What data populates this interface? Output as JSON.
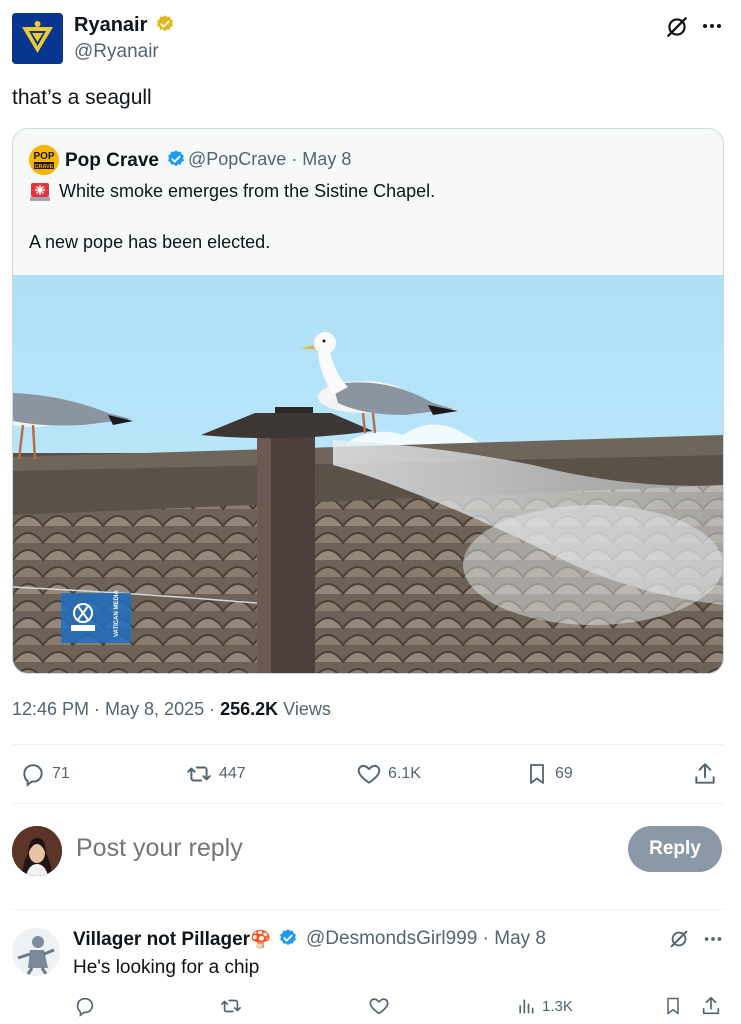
{
  "tweet": {
    "author_name": "Ryanair",
    "author_handle": "@Ryanair",
    "text": "that’s a seagull",
    "time": "12:46 PM · May 8, 2025 · ",
    "views_count": "256.2K",
    "views_label": " Views"
  },
  "quote": {
    "author_name": "Pop Crave",
    "meta": "@PopCrave · May 8",
    "line1": "White smoke emerges from the Sistine Chapel.",
    "line2": "A new pope has been elected.",
    "avatar_text_top": "POP",
    "avatar_text_bottom": "CRAVE",
    "watermark": "VATICAN MEDIA"
  },
  "actions": {
    "replies": "71",
    "reposts": "447",
    "likes": "6.1K",
    "bookmarks": "69"
  },
  "reply_box": {
    "placeholder": "Post your reply",
    "button_label": "Reply"
  },
  "comment": {
    "author_name": "Villager not Pillager",
    "author_emoji": "🍄",
    "meta": "@DesmondsGirl999 · May 8",
    "text": "He's looking for a chip",
    "views": "1.3K"
  },
  "colors": {
    "verified_gold": "#e2b719",
    "verified_blue": "#1d9bf0",
    "reply_button": "#8b98a5",
    "muted_text": "#536471"
  }
}
